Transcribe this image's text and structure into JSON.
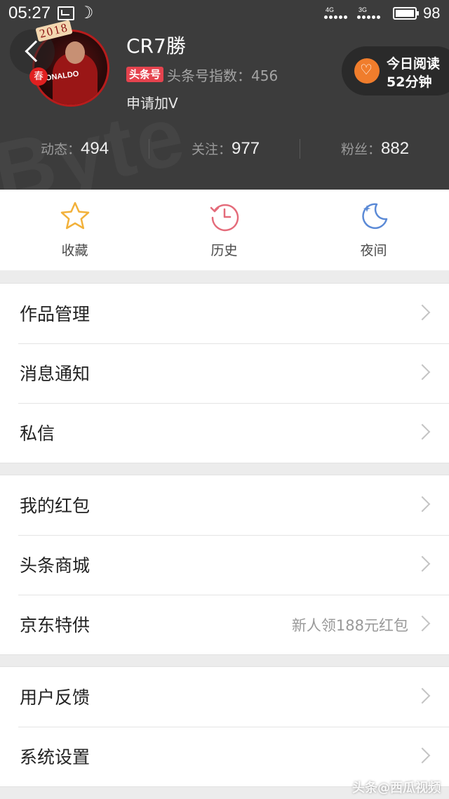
{
  "status_bar": {
    "time": "05:27",
    "network1": "4G",
    "network2": "3G",
    "battery": "98"
  },
  "profile": {
    "avatar_year": "2018",
    "avatar_name": "RONALDO",
    "avatar_badge": "春",
    "username": "CR7勝",
    "badge": "头条号",
    "index_text": "头条号指数：456",
    "apply_v": "申请加V"
  },
  "reading": {
    "label": "今日阅读",
    "value": "52分钟",
    "accent": "#f07d2c"
  },
  "stats": [
    {
      "label": "动态：",
      "value": "494"
    },
    {
      "label": "关注：",
      "value": "977"
    },
    {
      "label": "粉丝：",
      "value": "882"
    }
  ],
  "quick_actions": [
    {
      "label": "收藏",
      "icon": "star-icon",
      "color": "#f2b13a"
    },
    {
      "label": "历史",
      "icon": "history-clock-icon",
      "color": "#e46b7a"
    },
    {
      "label": "夜间",
      "icon": "moon-icon",
      "color": "#5b8ad6"
    }
  ],
  "menu_groups": [
    [
      {
        "label": "作品管理"
      },
      {
        "label": "消息通知"
      },
      {
        "label": "私信"
      }
    ],
    [
      {
        "label": "我的红包"
      },
      {
        "label": "头条商城"
      },
      {
        "label": "京东特供",
        "hint": "新人领188元红包"
      }
    ],
    [
      {
        "label": "用户反馈"
      },
      {
        "label": "系统设置"
      }
    ]
  ],
  "watermark": "头条@西瓜视频"
}
